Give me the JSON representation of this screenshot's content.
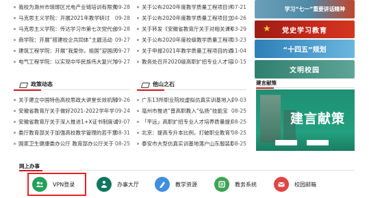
{
  "news_top_left": [
    {
      "title": "我校为滁州市琅琊区光电产业链培训有限责任公司",
      "date": "09-28"
    },
    {
      "title": "马克思主义学院：开展2021年教学研讨",
      "date": "09-28"
    },
    {
      "title": "马克思主义学院：传达学习市第七次党代会",
      "date": "09-28"
    },
    {
      "title": "商学院：开展“搭建校企共同体”主题活动",
      "date": "09-27"
    },
    {
      "title": "建筑工程学院：开展“我爱你，祖国”迎国庆",
      "date": "09-27"
    },
    {
      "title": "电气工程学院：以实现中华民族伟大复兴为",
      "date": "09-27"
    }
  ],
  "news_top_right": [
    {
      "title": "关于公布2020年度教学质量工程项目评审结果",
      "date": "07-21"
    },
    {
      "title": "关于公布2020年度教学质量工程项目立项",
      "date": "04-26"
    },
    {
      "title": "关于转发《安徽省教育厅关于对相关课程建设",
      "date": "03-29"
    },
    {
      "title": "关于公布2020年度校级教学质量工程项目",
      "date": "03-23"
    },
    {
      "title": "关于申报2021年教学质量工程项目的通知",
      "date": "11-04"
    },
    {
      "title": "教务处召开2020级高职扩招专业人才培养",
      "date": "10-15"
    }
  ],
  "section_policy": "政策动态",
  "section_other": "他山之石",
  "news_bottom_left": [
    {
      "title": "关于建立中国特色高校思政大讲堂长效机制的通知",
      "date": "09-26"
    },
    {
      "title": "安徽省教育厅关于做好2021-2022学年学",
      "date": "09-24"
    },
    {
      "title": "安徽省教育厅关于深入推进1+X证书制度试",
      "date": "09-07"
    },
    {
      "title": "委厅教育部关于加强高校教学管理的若干意见",
      "date": "08-31"
    },
    {
      "title": "国家卫生健康委办公厅 教育部办公厅关于",
      "date": "08-25"
    }
  ],
  "news_bottom_right": [
    {
      "title": "广东13所职业院校虚拟仿真实训基地入选",
      "date": "09-03"
    },
    {
      "title": "亳州市推进“普高职教入”弘扬“技能宝",
      "date": "08-25"
    },
    {
      "title": "「平远」高职扩招专业人才培养质量提升",
      "date": "08-25"
    },
    {
      "title": "北京：提高专升本比例，打破职业教育“天",
      "date": "08-25"
    },
    {
      "title": "泰安市大型仿真实训基地落户山东服装职业",
      "date": "08-25"
    }
  ],
  "banners": {
    "b1": "学习“七一”重要讲话精神",
    "b2": "党史学习教育",
    "b3": "“十四五”规划",
    "b4": "文明校园"
  },
  "jianyan": {
    "title": "建言献策",
    "box_text": "建言献策"
  },
  "online": {
    "title": "网上办事",
    "services": {
      "vpn": "VPN登录",
      "office": "办事大厅",
      "edu": "教学资源",
      "affairs": "教务系统",
      "mail": "校园邮箱"
    }
  }
}
